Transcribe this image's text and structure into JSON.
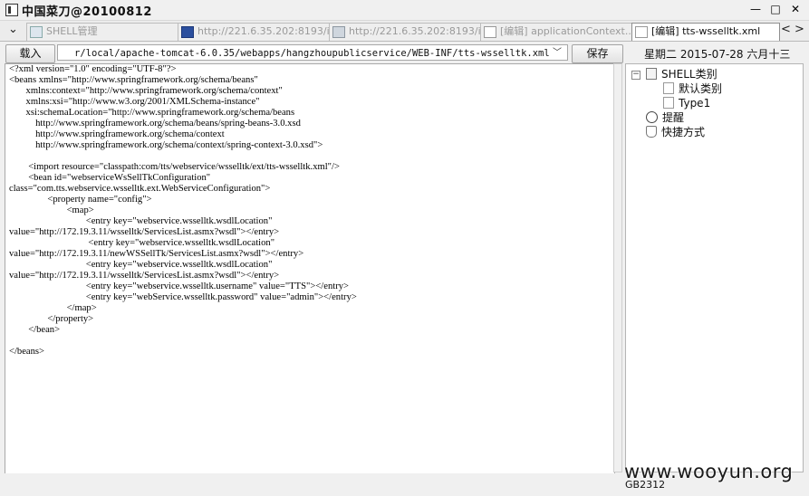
{
  "window": {
    "title": "中国菜刀@20100812",
    "minimize_glyph": "—",
    "maximize_glyph": "□",
    "close_glyph": "✕"
  },
  "tabs": [
    {
      "label": "SHELL管理",
      "icon": "shell-icon",
      "active": false
    },
    {
      "label": "http://221.6.35.202:8193/i...",
      "icon": "terminal-icon",
      "active": false
    },
    {
      "label": "http://221.6.35.202:8193/i...",
      "icon": "folder-icon",
      "active": false
    },
    {
      "label": "[编辑] applicationContext....",
      "icon": "file-icon",
      "active": false
    },
    {
      "label": "[编辑] tts-wsselltk.xml",
      "icon": "file-icon",
      "active": true
    }
  ],
  "tab_nav": {
    "menu_glyph": "⌄",
    "prev_glyph": "<",
    "next_glyph": ">"
  },
  "toolbar": {
    "load_label": "载入",
    "path_value": "r/local/apache-tomcat-6.0.35/webapps/hangzhoupublicservice/WEB-INF/tts-wsselltk.xml",
    "dropdown_glyph": "﹀",
    "save_label": "保存",
    "date_text": "星期二 2015-07-28 六月十三"
  },
  "editor": {
    "lines": [
      "<?xml version=\"1.0\" encoding=\"UTF-8\"?>",
      "<beans xmlns=\"http://www.springframework.org/schema/beans\"",
      "       xmlns:context=\"http://www.springframework.org/schema/context\"",
      "       xmlns:xsi=\"http://www.w3.org/2001/XMLSchema-instance\"",
      "       xsi:schemaLocation=\"http://www.springframework.org/schema/beans",
      "           http://www.springframework.org/schema/beans/spring-beans-3.0.xsd",
      "           http://www.springframework.org/schema/context",
      "           http://www.springframework.org/schema/context/spring-context-3.0.xsd\">",
      "",
      "        <import resource=\"classpath:com/tts/webservice/wsselltk/ext/tts-wsselltk.xml\"/>",
      "        <bean id=\"webserviceWsSellTkConfiguration\"",
      "class=\"com.tts.webservice.wsselltk.ext.WebServiceConfiguration\">",
      "                <property name=\"config\">",
      "                        <map>",
      "                                <entry key=\"webservice.wsselltk.wsdlLocation\"",
      "value=\"http://172.19.3.11/wsselltk/ServicesList.asmx?wsdl\"></entry>",
      "                                 <entry key=\"webservice.wsselltk.wsdlLocation\"",
      "value=\"http://172.19.3.11/newWSSellTk/ServicesList.asmx?wsdl\"></entry>",
      "                                <entry key=\"webservice.wsselltk.wsdlLocation\"",
      "value=\"http://172.19.3.11/wsselltk/ServicesList.asmx?wsdl\"></entry>",
      "                                <entry key=\"webservice.wsselltk.username\" value=\"TTS\"></entry>",
      "                                <entry key=\"webService.wsselltk.password\" value=\"admin\"></entry>",
      "                        </map>",
      "                </property>",
      "        </bean>",
      "",
      "</beans>"
    ]
  },
  "tree": {
    "root": {
      "label": "SHELL类别",
      "expander": "−"
    },
    "children": [
      {
        "label": "默认类别"
      },
      {
        "label": "Type1"
      }
    ],
    "reminder": {
      "label": "提醒"
    },
    "shortcut": {
      "label": "快捷方式"
    }
  },
  "status": {
    "encoding": "GB2312",
    "watermark": "www.wooyun.org"
  }
}
